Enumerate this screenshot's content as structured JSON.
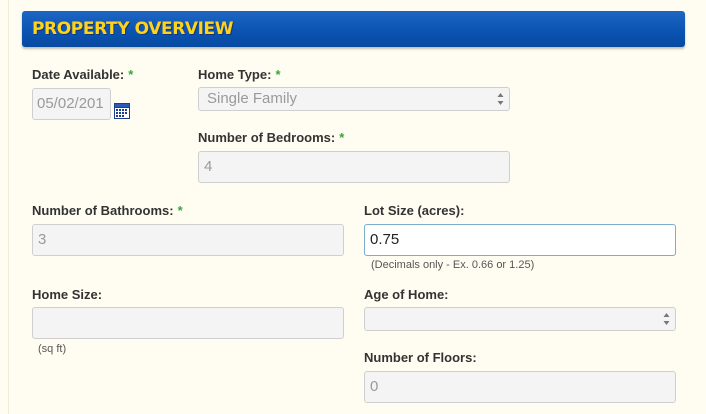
{
  "section": {
    "title": "PROPERTY OVERVIEW"
  },
  "required_marker": "*",
  "fields": {
    "date_available": {
      "label": "Date Available:",
      "value": "05/02/201",
      "icon": "calendar-icon"
    },
    "home_type": {
      "label": "Home Type:",
      "value": "Single Family"
    },
    "bedrooms": {
      "label": "Number of Bedrooms:",
      "value": "4"
    },
    "bathrooms": {
      "label": "Number of Bathrooms:",
      "value": "3"
    },
    "lot_size": {
      "label": "Lot Size (acres):",
      "value": "0.75",
      "hint": "(Decimals only - Ex. 0.66 or 1.25)"
    },
    "home_size": {
      "label": "Home Size:",
      "value": "",
      "hint": "(sq ft)"
    },
    "age_of_home": {
      "label": "Age of Home:",
      "value": ""
    },
    "floors": {
      "label": "Number of Floors:",
      "value": "0"
    }
  },
  "colors": {
    "header": "#0b54b3",
    "header_text": "#ffd21c",
    "required": "#3aa43a",
    "page_bg": "#fffdf2"
  }
}
